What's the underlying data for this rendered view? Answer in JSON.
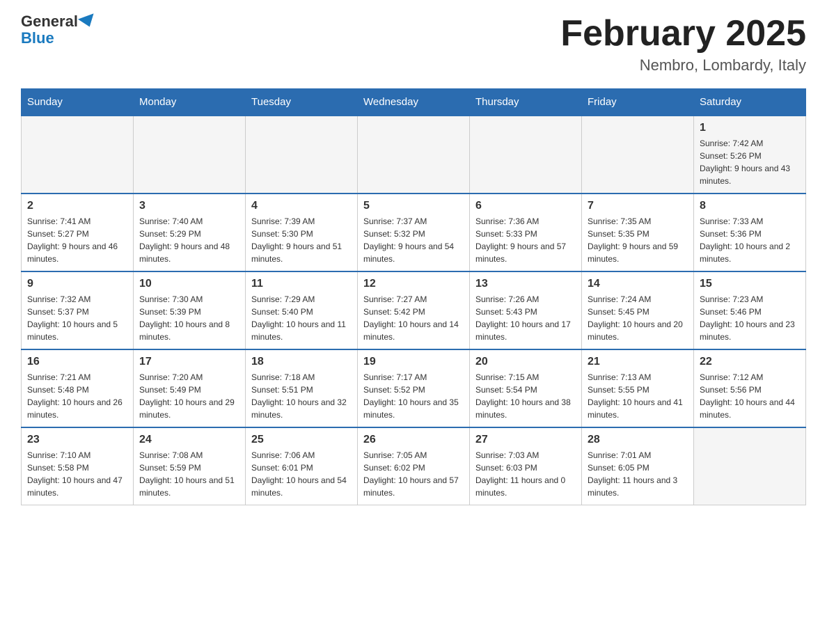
{
  "header": {
    "logo_general": "General",
    "logo_blue": "Blue",
    "title": "February 2025",
    "location": "Nembro, Lombardy, Italy"
  },
  "days_of_week": [
    "Sunday",
    "Monday",
    "Tuesday",
    "Wednesday",
    "Thursday",
    "Friday",
    "Saturday"
  ],
  "weeks": [
    [
      {
        "day": "",
        "info": ""
      },
      {
        "day": "",
        "info": ""
      },
      {
        "day": "",
        "info": ""
      },
      {
        "day": "",
        "info": ""
      },
      {
        "day": "",
        "info": ""
      },
      {
        "day": "",
        "info": ""
      },
      {
        "day": "1",
        "info": "Sunrise: 7:42 AM\nSunset: 5:26 PM\nDaylight: 9 hours and 43 minutes."
      }
    ],
    [
      {
        "day": "2",
        "info": "Sunrise: 7:41 AM\nSunset: 5:27 PM\nDaylight: 9 hours and 46 minutes."
      },
      {
        "day": "3",
        "info": "Sunrise: 7:40 AM\nSunset: 5:29 PM\nDaylight: 9 hours and 48 minutes."
      },
      {
        "day": "4",
        "info": "Sunrise: 7:39 AM\nSunset: 5:30 PM\nDaylight: 9 hours and 51 minutes."
      },
      {
        "day": "5",
        "info": "Sunrise: 7:37 AM\nSunset: 5:32 PM\nDaylight: 9 hours and 54 minutes."
      },
      {
        "day": "6",
        "info": "Sunrise: 7:36 AM\nSunset: 5:33 PM\nDaylight: 9 hours and 57 minutes."
      },
      {
        "day": "7",
        "info": "Sunrise: 7:35 AM\nSunset: 5:35 PM\nDaylight: 9 hours and 59 minutes."
      },
      {
        "day": "8",
        "info": "Sunrise: 7:33 AM\nSunset: 5:36 PM\nDaylight: 10 hours and 2 minutes."
      }
    ],
    [
      {
        "day": "9",
        "info": "Sunrise: 7:32 AM\nSunset: 5:37 PM\nDaylight: 10 hours and 5 minutes."
      },
      {
        "day": "10",
        "info": "Sunrise: 7:30 AM\nSunset: 5:39 PM\nDaylight: 10 hours and 8 minutes."
      },
      {
        "day": "11",
        "info": "Sunrise: 7:29 AM\nSunset: 5:40 PM\nDaylight: 10 hours and 11 minutes."
      },
      {
        "day": "12",
        "info": "Sunrise: 7:27 AM\nSunset: 5:42 PM\nDaylight: 10 hours and 14 minutes."
      },
      {
        "day": "13",
        "info": "Sunrise: 7:26 AM\nSunset: 5:43 PM\nDaylight: 10 hours and 17 minutes."
      },
      {
        "day": "14",
        "info": "Sunrise: 7:24 AM\nSunset: 5:45 PM\nDaylight: 10 hours and 20 minutes."
      },
      {
        "day": "15",
        "info": "Sunrise: 7:23 AM\nSunset: 5:46 PM\nDaylight: 10 hours and 23 minutes."
      }
    ],
    [
      {
        "day": "16",
        "info": "Sunrise: 7:21 AM\nSunset: 5:48 PM\nDaylight: 10 hours and 26 minutes."
      },
      {
        "day": "17",
        "info": "Sunrise: 7:20 AM\nSunset: 5:49 PM\nDaylight: 10 hours and 29 minutes."
      },
      {
        "day": "18",
        "info": "Sunrise: 7:18 AM\nSunset: 5:51 PM\nDaylight: 10 hours and 32 minutes."
      },
      {
        "day": "19",
        "info": "Sunrise: 7:17 AM\nSunset: 5:52 PM\nDaylight: 10 hours and 35 minutes."
      },
      {
        "day": "20",
        "info": "Sunrise: 7:15 AM\nSunset: 5:54 PM\nDaylight: 10 hours and 38 minutes."
      },
      {
        "day": "21",
        "info": "Sunrise: 7:13 AM\nSunset: 5:55 PM\nDaylight: 10 hours and 41 minutes."
      },
      {
        "day": "22",
        "info": "Sunrise: 7:12 AM\nSunset: 5:56 PM\nDaylight: 10 hours and 44 minutes."
      }
    ],
    [
      {
        "day": "23",
        "info": "Sunrise: 7:10 AM\nSunset: 5:58 PM\nDaylight: 10 hours and 47 minutes."
      },
      {
        "day": "24",
        "info": "Sunrise: 7:08 AM\nSunset: 5:59 PM\nDaylight: 10 hours and 51 minutes."
      },
      {
        "day": "25",
        "info": "Sunrise: 7:06 AM\nSunset: 6:01 PM\nDaylight: 10 hours and 54 minutes."
      },
      {
        "day": "26",
        "info": "Sunrise: 7:05 AM\nSunset: 6:02 PM\nDaylight: 10 hours and 57 minutes."
      },
      {
        "day": "27",
        "info": "Sunrise: 7:03 AM\nSunset: 6:03 PM\nDaylight: 11 hours and 0 minutes."
      },
      {
        "day": "28",
        "info": "Sunrise: 7:01 AM\nSunset: 6:05 PM\nDaylight: 11 hours and 3 minutes."
      },
      {
        "day": "",
        "info": ""
      }
    ]
  ],
  "accent_color": "#2b6cb0"
}
